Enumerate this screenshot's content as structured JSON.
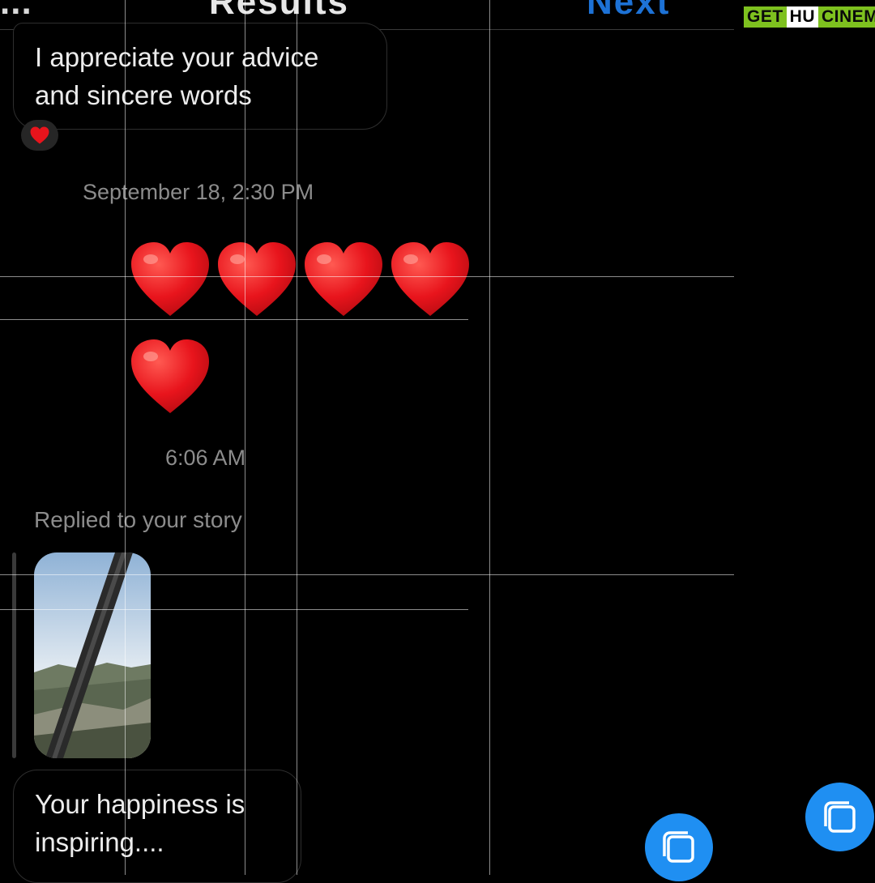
{
  "header": {
    "left_text": "...",
    "center_text": "Results",
    "right_text": "Next"
  },
  "watermark": {
    "part1": "GET",
    "part2": "HU",
    "part3": "CINEMA",
    "colors": {
      "green": "#7ec11f",
      "white": "#ffffff"
    }
  },
  "messages": [
    {
      "text_line1": "I appreciate your advice",
      "text_line2": "and sincere words",
      "reaction_icon": "red-heart-icon"
    },
    {
      "text_line1": "Your happiness is",
      "text_line2": "inspiring...."
    }
  ],
  "timestamps": [
    "September 18, 2:30 PM",
    "6:06 AM"
  ],
  "hearts_message": {
    "emoji": "red-heart-icon",
    "count": 5
  },
  "story_reply": {
    "label": "Replied to your story"
  },
  "buttons": {
    "copy_icon": "copy-icon"
  },
  "colors": {
    "accent": "#1f8ff2",
    "heart": "#e8141c",
    "bubble_border": "#2e2e2e",
    "timestamp": "#8c8c8c"
  }
}
